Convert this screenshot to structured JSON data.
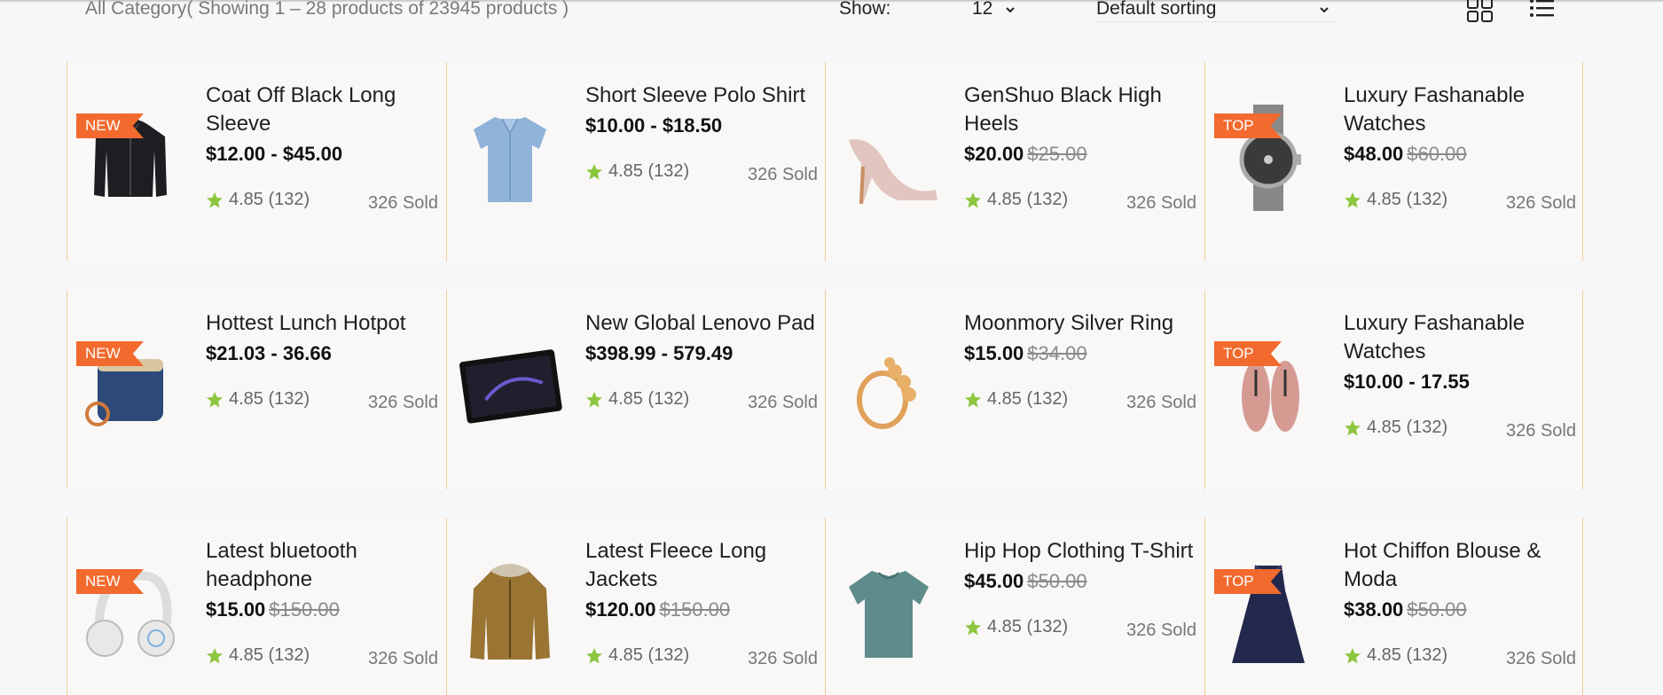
{
  "toolbar": {
    "showing_text": "All Category( Showing 1 – 28 products of 23945 products )",
    "show_label": "Show:",
    "show_value": "12",
    "sort_value": "Default sorting",
    "grid_icon": "grid-view-icon",
    "list_icon": "list-view-icon"
  },
  "colors": {
    "badge": "#f26a2e",
    "star": "#8cc63f",
    "card_border": "#f2cf9a"
  },
  "products": [
    {
      "title": "Coat Off Black Long Sleeve",
      "price": "$12.00 - $45.00",
      "old_price": "",
      "badge": "NEW",
      "rating": "4.85 (132)",
      "sold": "326 Sold",
      "image": "black-hoodie"
    },
    {
      "title": "Short Sleeve Polo Shirt",
      "price": "$10.00 - $18.50",
      "old_price": "",
      "badge": "",
      "rating": "4.85 (132)",
      "sold": "326 Sold",
      "image": "blue-shirt"
    },
    {
      "title": "GenShuo Black High Heels",
      "price": "$20.00",
      "old_price": "$25.00",
      "badge": "",
      "rating": "4.85 (132)",
      "sold": "326 Sold",
      "image": "high-heel"
    },
    {
      "title": "Luxury Fashanable Watches",
      "price": "$48.00",
      "old_price": "$60.00",
      "badge": "TOP",
      "rating": "4.85 (132)",
      "sold": "326 Sold",
      "image": "watch"
    },
    {
      "title": "Hottest Lunch Hotpot",
      "price": "$21.03 - 36.66",
      "old_price": "",
      "badge": "NEW",
      "rating": "4.85 (132)",
      "sold": "326 Sold",
      "image": "speaker"
    },
    {
      "title": "New Global Lenovo Pad",
      "price": "$398.99 - 579.49",
      "old_price": "",
      "badge": "",
      "rating": "4.85 (132)",
      "sold": "326 Sold",
      "image": "tablet"
    },
    {
      "title": "Moonmory Silver Ring",
      "price": "$15.00",
      "old_price": "$34.00",
      "badge": "",
      "rating": "4.85 (132)",
      "sold": "326 Sold",
      "image": "ring"
    },
    {
      "title": "Luxury Fashanable Watches",
      "price": "$10.00 - 17.55",
      "old_price": "",
      "badge": "TOP",
      "rating": "4.85 (132)",
      "sold": "326 Sold",
      "image": "pink-shoes"
    },
    {
      "title": "Latest bluetooth headphone",
      "price": "$15.00",
      "old_price": "$150.00",
      "badge": "NEW",
      "rating": "4.85 (132)",
      "sold": "326 Sold",
      "image": "headphone"
    },
    {
      "title": "Latest Fleece Long Jackets",
      "price": "$120.00",
      "old_price": "$150.00",
      "badge": "",
      "rating": "4.85 (132)",
      "sold": "326 Sold",
      "image": "jacket"
    },
    {
      "title": "Hip Hop Clothing T-Shirt",
      "price": "$45.00",
      "old_price": "$50.00",
      "badge": "",
      "rating": "4.85 (132)",
      "sold": "326 Sold",
      "image": "tshirt"
    },
    {
      "title": "Hot Chiffon Blouse & Moda",
      "price": "$38.00",
      "old_price": "$50.00",
      "badge": "TOP",
      "rating": "4.85 (132)",
      "sold": "326 Sold",
      "image": "dress"
    }
  ]
}
